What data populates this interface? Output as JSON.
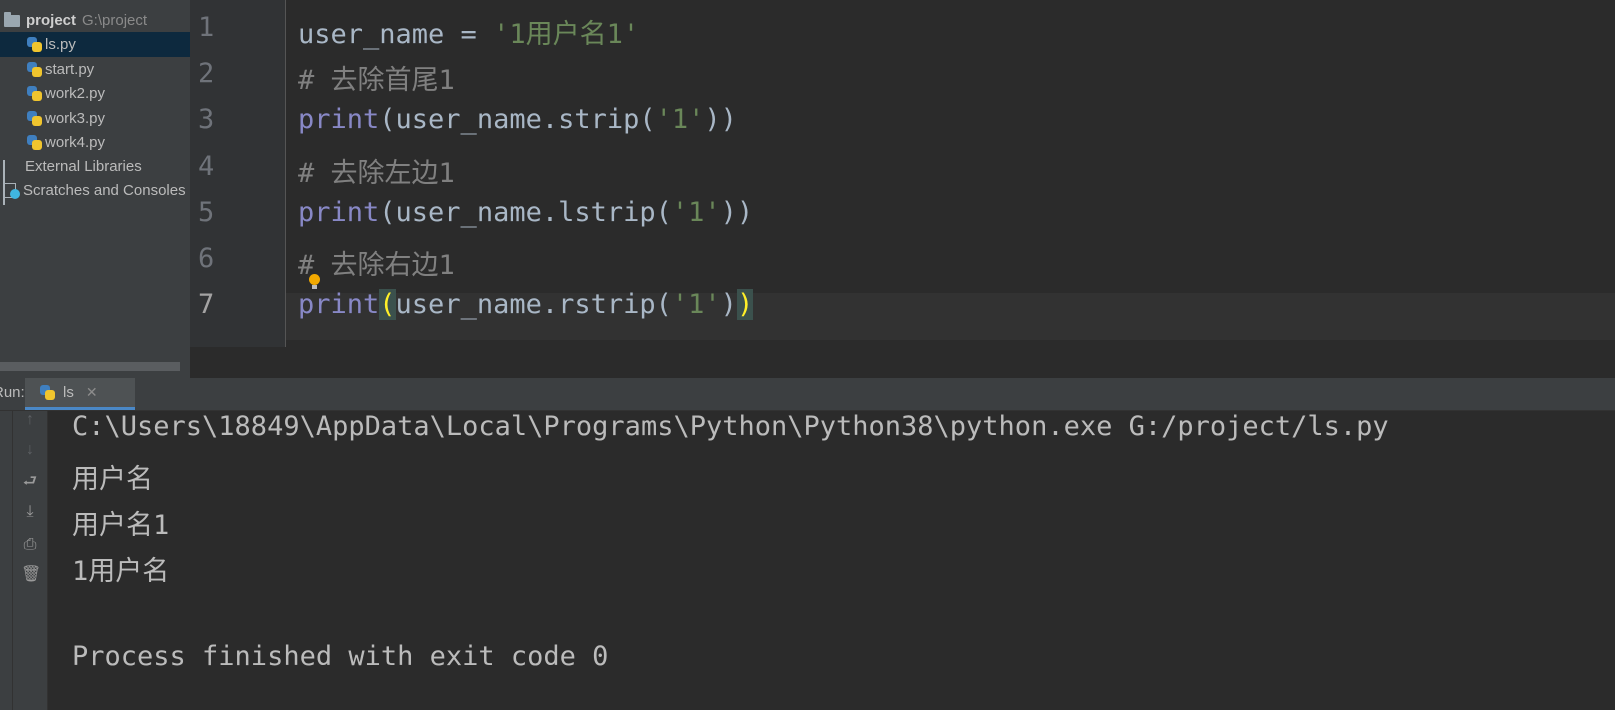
{
  "project_tree": {
    "root": {
      "name": "project",
      "path": "G:\\project"
    },
    "files": [
      "ls.py",
      "start.py",
      "work2.py",
      "work3.py",
      "work4.py"
    ],
    "selected_file": "ls.py",
    "external_libraries": "External Libraries",
    "scratches": "Scratches and Consoles"
  },
  "editor": {
    "current_line": 7,
    "lines": [
      {
        "number": "1",
        "tokens": [
          {
            "t": "user_name = "
          },
          {
            "t": "'1用户名1'",
            "c": "str"
          }
        ]
      },
      {
        "number": "2",
        "tokens": [
          {
            "t": "# 去除首尾1",
            "c": "cmt"
          }
        ]
      },
      {
        "number": "3",
        "tokens": [
          {
            "t": "print",
            "c": "kw"
          },
          {
            "t": "(user_name.strip("
          },
          {
            "t": "'1'",
            "c": "str"
          },
          {
            "t": "))"
          }
        ]
      },
      {
        "number": "4",
        "tokens": [
          {
            "t": "# 去除左边1",
            "c": "cmt"
          }
        ]
      },
      {
        "number": "5",
        "tokens": [
          {
            "t": "print",
            "c": "kw"
          },
          {
            "t": "(user_name.lstrip("
          },
          {
            "t": "'1'",
            "c": "str"
          },
          {
            "t": "))"
          }
        ]
      },
      {
        "number": "6",
        "tokens": [
          {
            "t": "# 去除右边1",
            "c": "cmt"
          }
        ]
      },
      {
        "number": "7",
        "tokens": [
          {
            "t": "print",
            "c": "kw"
          },
          {
            "t": "(",
            "c": "brace-hl"
          },
          {
            "t": "user_name.rstrip("
          },
          {
            "t": "'1'",
            "c": "str"
          },
          {
            "t": ")"
          },
          {
            "t": ")",
            "c": "brace-hl"
          }
        ]
      }
    ]
  },
  "run_panel": {
    "label": "Run:",
    "tab_name": "ls",
    "output": [
      "C:\\Users\\18849\\AppData\\Local\\Programs\\Python\\Python38\\python.exe G:/project/ls.py",
      "用户名",
      "用户名1",
      "1用户名",
      "",
      "Process finished with exit code 0"
    ]
  }
}
